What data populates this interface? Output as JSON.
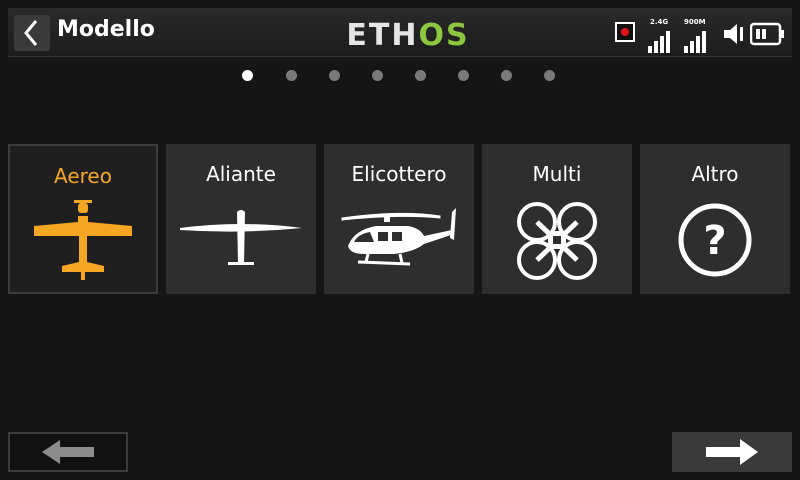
{
  "header": {
    "title": "Modello",
    "logo_text": "ETHOS",
    "status": {
      "band_24": "2.4G",
      "band_900": "900M"
    }
  },
  "pager": {
    "count": 8,
    "active": 0
  },
  "model_types": [
    {
      "label": "Aereo",
      "icon": "airplane-icon",
      "selected": true
    },
    {
      "label": "Aliante",
      "icon": "glider-icon",
      "selected": false
    },
    {
      "label": "Elicottero",
      "icon": "helicopter-icon",
      "selected": false
    },
    {
      "label": "Multi",
      "icon": "multirotor-icon",
      "selected": false
    },
    {
      "label": "Altro",
      "icon": "question-icon",
      "selected": false
    }
  ],
  "colors": {
    "accent": "#f5a623",
    "logo_green": "#8dc63f",
    "record": "#e01414"
  }
}
